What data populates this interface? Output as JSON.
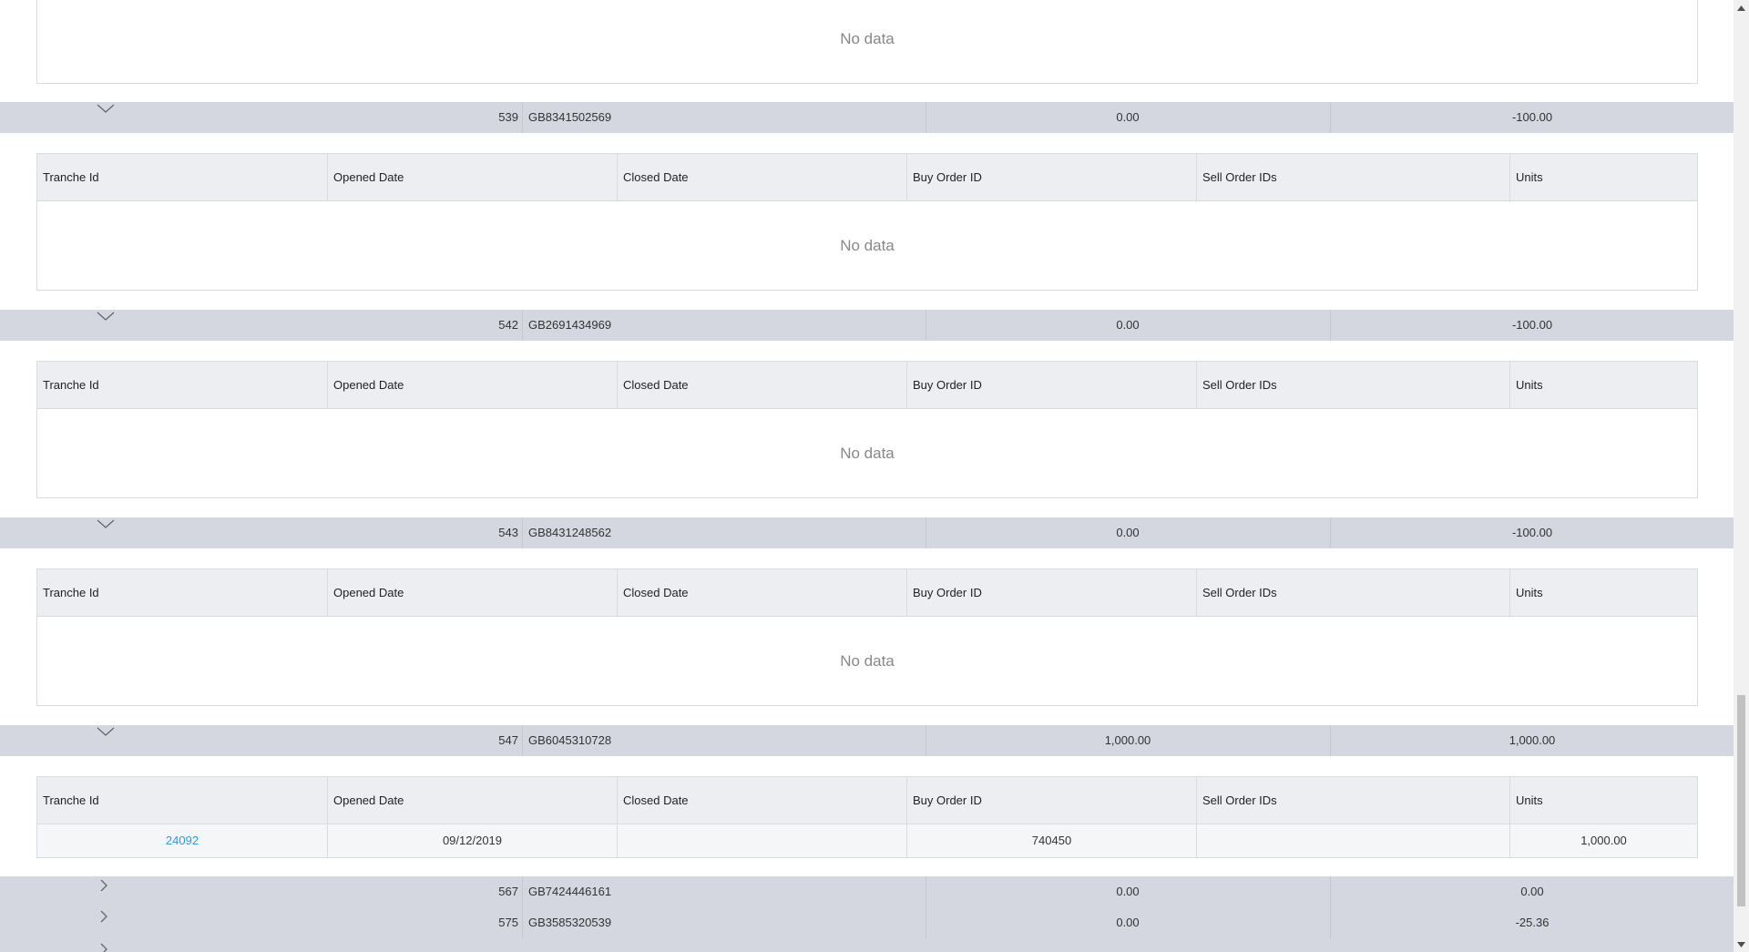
{
  "detail_headers": [
    "Tranche Id",
    "Opened Date",
    "Closed Date",
    "Buy Order ID",
    "Sell Order IDs",
    "Units"
  ],
  "no_data_text": "No data",
  "top_partial": {
    "no_data": "No data"
  },
  "groups": [
    {
      "id": "539",
      "isin": "GB8341502569",
      "value1": "0.00",
      "value2": "-100.00",
      "expanded": true
    },
    {
      "id": "542",
      "isin": "GB2691434969",
      "value1": "0.00",
      "value2": "-100.00",
      "expanded": true
    },
    {
      "id": "543",
      "isin": "GB8431248562",
      "value1": "0.00",
      "value2": "-100.00",
      "expanded": true
    },
    {
      "id": "547",
      "isin": "GB6045310728",
      "value1": "1,000.00",
      "value2": "1,000.00",
      "expanded": true
    },
    {
      "id": "567",
      "isin": "GB7424446161",
      "value1": "0.00",
      "value2": "0.00",
      "expanded": false
    },
    {
      "id": "575",
      "isin": "GB3585320539",
      "value1": "0.00",
      "value2": "-25.36",
      "expanded": false
    }
  ],
  "tranche_row": {
    "tranche_id": "24092",
    "opened_date": "09/12/2019",
    "closed_date": "",
    "buy_order_id": "740450",
    "sell_order_ids": "",
    "units": "1,000.00"
  },
  "scrollbar": {
    "position_fraction": 0.6
  }
}
